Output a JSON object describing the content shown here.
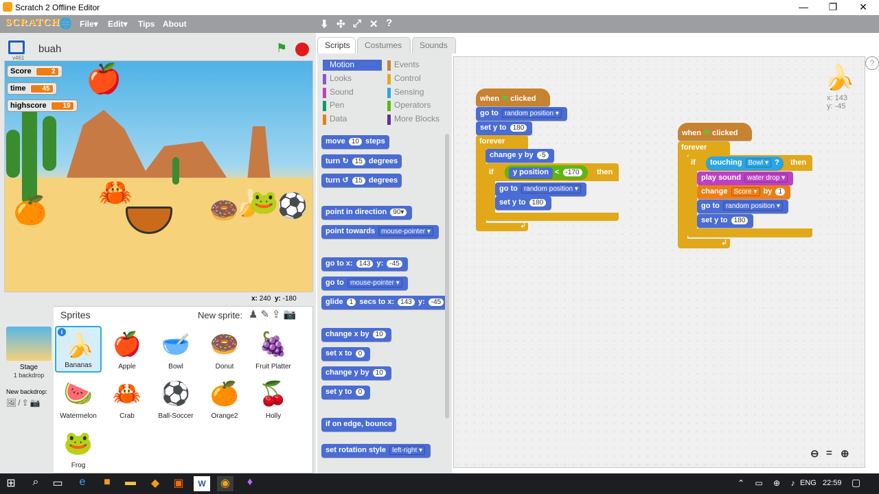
{
  "window": {
    "title": "Scratch 2 Offline Editor",
    "min": "—",
    "max": "❐",
    "close": "✕"
  },
  "menu": {
    "logo": "SCRATCH",
    "file": "File▾",
    "edit": "Edit▾",
    "tips": "Tips",
    "about": "About"
  },
  "stage": {
    "name": "buah",
    "version": "v461",
    "coords_x_label": "x:",
    "coords_x": "240",
    "coords_y_label": "y:",
    "coords_y": "-180",
    "monitors": [
      {
        "label": "Score",
        "value": "2"
      },
      {
        "label": "time",
        "value": "45"
      },
      {
        "label": "highscore",
        "value": "19"
      }
    ]
  },
  "sprites_panel": {
    "title": "Sprites",
    "new_sprite": "New sprite:",
    "stage_label": "Stage",
    "stage_sub": "1 backdrop",
    "new_backdrop": "New backdrop:",
    "sprites": [
      {
        "name": "Bananas",
        "icon": "🍌"
      },
      {
        "name": "Apple",
        "icon": "🍎"
      },
      {
        "name": "Bowl",
        "icon": "🥣"
      },
      {
        "name": "Donut",
        "icon": "🍩"
      },
      {
        "name": "Fruit Platter",
        "icon": "🍇"
      },
      {
        "name": "Watermelon",
        "icon": "🍉"
      },
      {
        "name": "Crab",
        "icon": "🦀"
      },
      {
        "name": "Ball-Soccer",
        "icon": "⚽"
      },
      {
        "name": "Orange2",
        "icon": "🍊"
      },
      {
        "name": "Holly",
        "icon": "🍒"
      },
      {
        "name": "Frog",
        "icon": "🐸"
      }
    ]
  },
  "tabs": [
    "Scripts",
    "Costumes",
    "Sounds"
  ],
  "categories": [
    {
      "name": "Motion",
      "color": "#4a6cd4"
    },
    {
      "name": "Looks",
      "color": "#8a55d7"
    },
    {
      "name": "Sound",
      "color": "#bb42c3"
    },
    {
      "name": "Pen",
      "color": "#0e9a6c"
    },
    {
      "name": "Data",
      "color": "#ee7d16"
    },
    {
      "name": "Events",
      "color": "#c88330"
    },
    {
      "name": "Control",
      "color": "#e1a91a"
    },
    {
      "name": "Sensing",
      "color": "#2ca5e2"
    },
    {
      "name": "Operators",
      "color": "#5cb712"
    },
    {
      "name": "More Blocks",
      "color": "#632d99"
    }
  ],
  "palette": {
    "move": "move",
    "move_n": "10",
    "steps": "steps",
    "turn": "turn",
    "turn_r": "15",
    "degrees": "degrees",
    "turn_l": "15",
    "point_dir": "point in direction",
    "point_dir_v": "90▾",
    "point_towards": "point towards",
    "point_towards_v": "mouse-pointer ▾",
    "goto_xy": "go to x:",
    "goto_x": "143",
    "goto_y_l": "y:",
    "goto_y": "-45",
    "goto": "go to",
    "goto_v": "mouse-pointer ▾",
    "glide": "glide",
    "glide_n": "1",
    "glide_secs": "secs to x:",
    "glide_x": "143",
    "glide_y_l": "y:",
    "glide_y": "-45",
    "change_x": "change x by",
    "change_x_v": "10",
    "set_x": "set x to",
    "set_x_v": "0",
    "change_y": "change y by",
    "change_y_v": "10",
    "set_y": "set y to",
    "set_y_v": "0",
    "bounce": "if on edge, bounce",
    "rot": "set rotation style",
    "rot_v": "left-right ▾"
  },
  "script1": {
    "when": "when",
    "clicked": "clicked",
    "goto": "go to",
    "goto_v": "random position ▾",
    "sety": "set y to",
    "sety_v": "180",
    "forever": "forever",
    "changey": "change y by",
    "changey_v": "-5",
    "if": "if",
    "ypos": "y position",
    "lt": "<",
    "lt_v": "-170",
    "then": "then",
    "goto2": "go to",
    "goto2_v": "random position ▾",
    "sety2": "set y to",
    "sety2_v": "180"
  },
  "script2": {
    "when": "when",
    "clicked": "clicked",
    "forever": "forever",
    "if": "if",
    "touching": "touching",
    "touching_v": "Bowl ▾",
    "q": "?",
    "then": "then",
    "play": "play sound",
    "play_v": "water drop ▾",
    "change": "change",
    "change_v": "Score ▾",
    "by": "by",
    "by_v": "1",
    "goto": "go to",
    "goto_v": "random position ▾",
    "sety": "set y to",
    "sety_v": "180"
  },
  "sprite_info": {
    "x_label": "x:",
    "x": "143",
    "y_label": "y:",
    "y": "-45"
  },
  "taskbar": {
    "lang": "ENG",
    "time": "22:59"
  }
}
